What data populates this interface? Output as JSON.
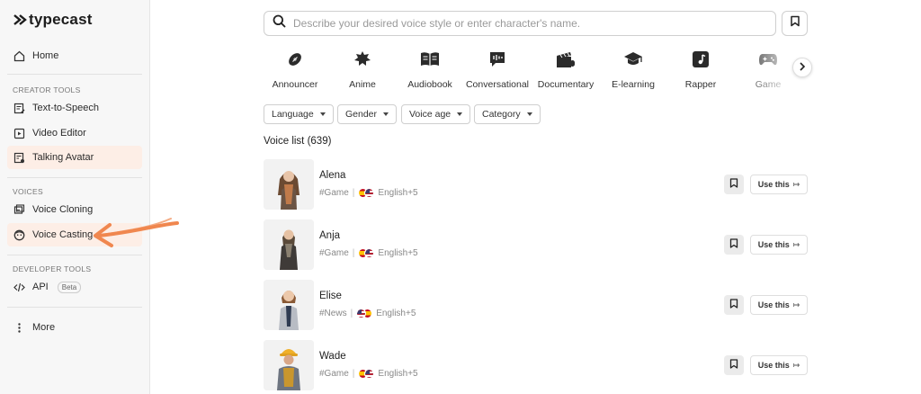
{
  "brand": {
    "name": "typecast",
    "accent": "#f08a5d"
  },
  "sidebar": {
    "home": "Home",
    "sections": [
      {
        "label": "CREATOR TOOLS",
        "items": [
          "Text-to-Speech",
          "Video Editor",
          "Talking Avatar"
        ]
      },
      {
        "label": "VOICES",
        "items": [
          "Voice Cloning",
          "Voice Casting"
        ]
      },
      {
        "label": "DEVELOPER TOOLS",
        "items": [
          "API"
        ]
      }
    ],
    "api_badge": "Beta",
    "more": "More"
  },
  "search": {
    "placeholder": "Describe your desired voice style or enter character's name."
  },
  "categories": [
    {
      "label": "Announcer",
      "icon": "football-icon"
    },
    {
      "label": "Anime",
      "icon": "anime-icon"
    },
    {
      "label": "Audiobook",
      "icon": "book-icon"
    },
    {
      "label": "Conversational",
      "icon": "chat-icon"
    },
    {
      "label": "Documentary",
      "icon": "clapper-icon"
    },
    {
      "label": "E-learning",
      "icon": "graduation-cap-icon"
    },
    {
      "label": "Rapper",
      "icon": "music-note-icon"
    },
    {
      "label": "Game",
      "icon": "gamepad-icon"
    }
  ],
  "filters": [
    "Language",
    "Gender",
    "Voice age",
    "Category"
  ],
  "voice_list": {
    "title": "Voice list (639)",
    "use_label": "Use this",
    "voices": [
      {
        "name": "Alena",
        "tag": "#Game",
        "language": "English+5"
      },
      {
        "name": "Anja",
        "tag": "#Game",
        "language": "English+5"
      },
      {
        "name": "Elise",
        "tag": "#News",
        "language": "English+5"
      },
      {
        "name": "Wade",
        "tag": "#Game",
        "language": "English+5"
      }
    ]
  }
}
